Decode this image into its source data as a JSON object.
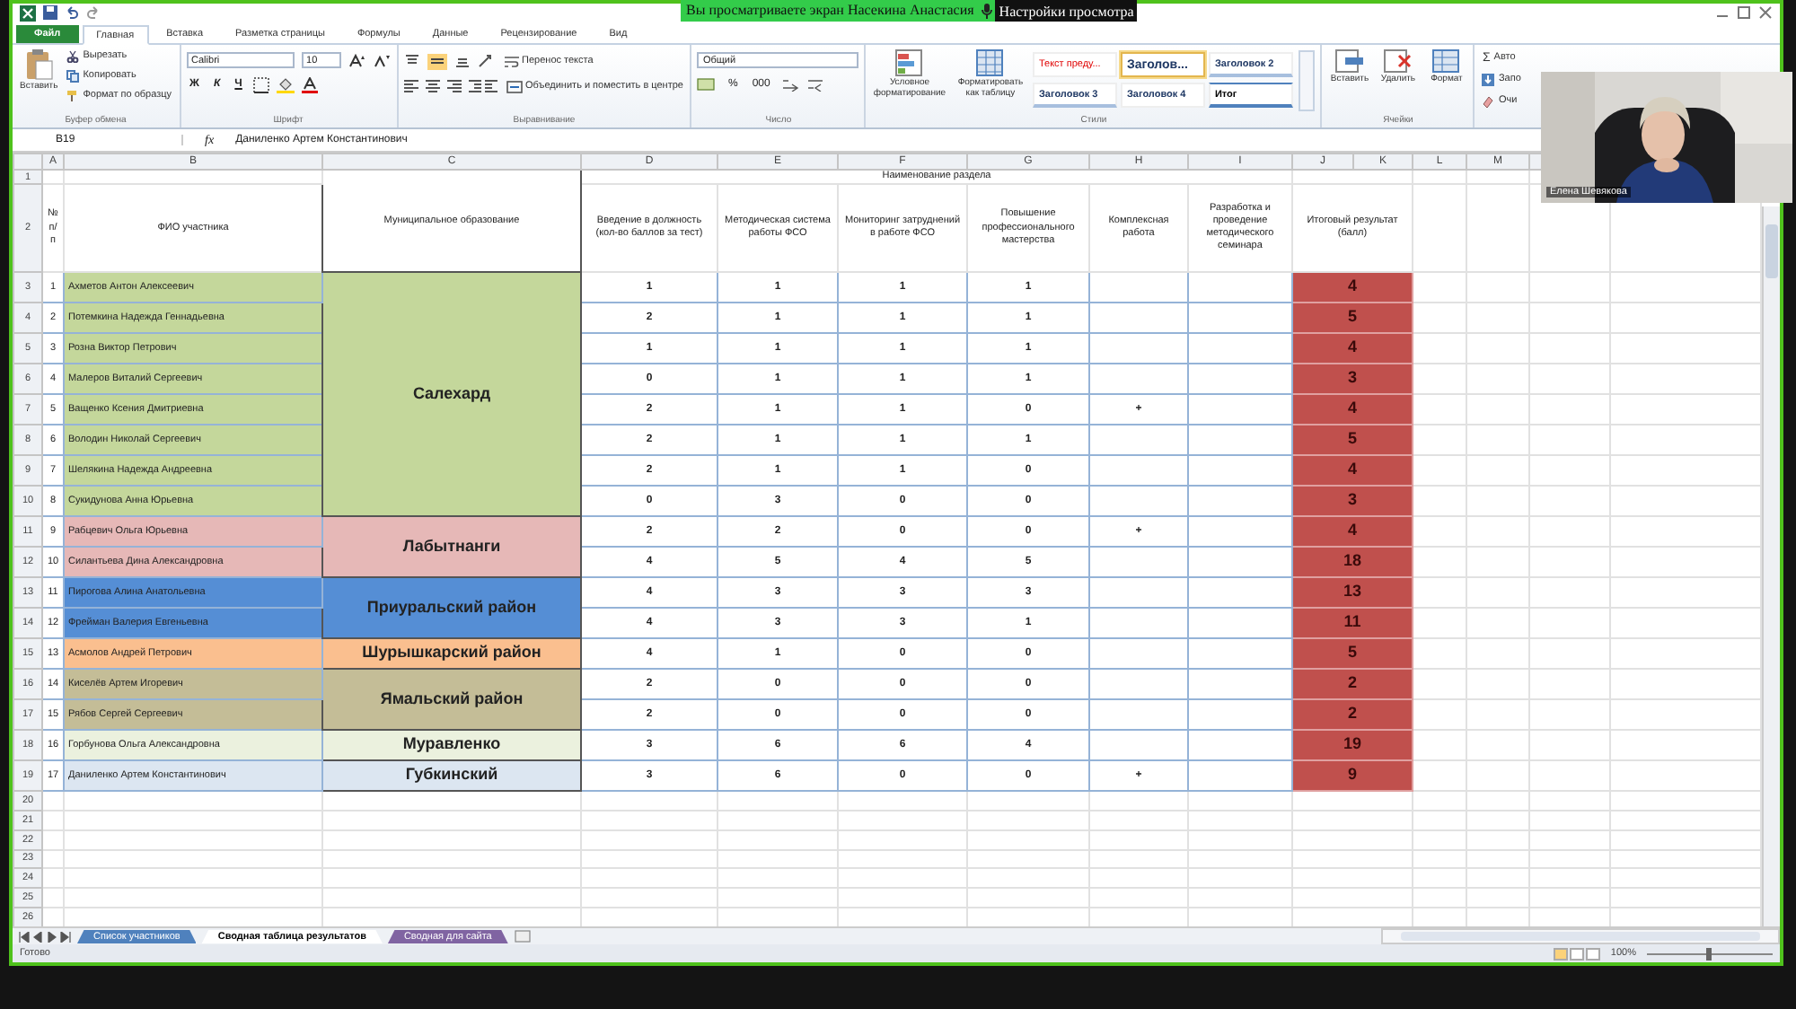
{
  "banner": {
    "text": "Вы просматриваете экран Насекина Анастасия",
    "settings": "Настройки просмотра"
  },
  "ribbon_tabs": [
    {
      "label": "Файл",
      "kind": "file",
      "selected": false
    },
    {
      "label": "Главная",
      "kind": "tab",
      "selected": true
    },
    {
      "label": "Вставка",
      "kind": "tab",
      "selected": false
    },
    {
      "label": "Разметка страницы",
      "kind": "tab",
      "selected": false
    },
    {
      "label": "Формулы",
      "kind": "tab",
      "selected": false
    },
    {
      "label": "Данные",
      "kind": "tab",
      "selected": false
    },
    {
      "label": "Рецензирование",
      "kind": "tab",
      "selected": false
    },
    {
      "label": "Вид",
      "kind": "tab",
      "selected": false
    }
  ],
  "clipboard": {
    "paste": "Вставить",
    "cut": "Вырезать",
    "copy": "Копировать",
    "format_painter": "Формат по образцу",
    "label": "Буфер обмена"
  },
  "font": {
    "family": "Calibri",
    "size": "10",
    "bold": "Ж",
    "italic": "К",
    "underline": "Ч",
    "label": "Шрифт"
  },
  "alignment": {
    "wrap": "Перенос текста",
    "merge": "Объединить и поместить в центре",
    "label": "Выравнивание"
  },
  "number": {
    "format": "Общий",
    "percent": "%",
    "thousands": "000",
    "label": "Число"
  },
  "styles": {
    "conditional": "Условное форматирование",
    "as_table": "Форматировать как таблицу",
    "label": "Стили",
    "gallery": [
      {
        "label": "Текст преду...",
        "kind": "warning",
        "selected": false
      },
      {
        "label": "Заголов...",
        "kind": "title",
        "selected": true
      },
      {
        "label": "Заголовок 2",
        "kind": "heading",
        "selected": false
      },
      {
        "label": "Заголовок 3",
        "kind": "heading",
        "selected": false
      },
      {
        "label": "Заголовок 4",
        "kind": "plain",
        "selected": false
      },
      {
        "label": "Итог",
        "kind": "total",
        "selected": false
      }
    ]
  },
  "cells": {
    "insert": "Вставить",
    "delete": "Удалить",
    "format": "Формат",
    "label": "Ячейки"
  },
  "editing": {
    "sigma": "Σ",
    "autosum": "Авто",
    "fill": "Запо",
    "clear": "Очи"
  },
  "formula_bar": {
    "name_box": "B19",
    "fx": "fx",
    "content": "Даниленко Артем Константинович"
  },
  "column_headers": [
    "A",
    "B",
    "C",
    "D",
    "E",
    "F",
    "G",
    "H",
    "I",
    "J",
    "K",
    "L",
    "M"
  ],
  "row_headers": [
    "1",
    "2",
    "3",
    "4",
    "5",
    "6",
    "7",
    "8",
    "9",
    "10",
    "11",
    "12",
    "13",
    "14",
    "15",
    "16",
    "17",
    "18",
    "19",
    "20",
    "21",
    "22",
    "23",
    "24",
    "25",
    "26"
  ],
  "table": {
    "section_title": "Наименование раздела",
    "num_header": "№ п/п",
    "name_header": "ФИО участника",
    "municipality_header": "Муниципальное образование",
    "score_headers": [
      "Введение в должность (кол-во баллов за тест)",
      "Методическая система работы ФСО",
      "Мониторинг затруднений в работе ФСО",
      "Повышение профессионального мастерства",
      "Комплексная работа",
      "Разработка и проведение методического семинара"
    ],
    "result_header": "Итоговый результат (балл)"
  },
  "groups": [
    {
      "municipality": "Салехард",
      "color": "#c4d79b",
      "rows": [
        {
          "num": "1",
          "name": "Ахметов Антон Алексеевич",
          "scores": [
            "1",
            "1",
            "1",
            "1"
          ],
          "result": "4"
        },
        {
          "num": "2",
          "name": "Потемкина Надежда Геннадьевна",
          "scores": [
            "2",
            "1",
            "1",
            "1"
          ],
          "result": "5"
        },
        {
          "num": "3",
          "name": "Розна Виктор Петрович",
          "scores": [
            "1",
            "1",
            "1",
            "1"
          ],
          "result": "4"
        },
        {
          "num": "4",
          "name": "Малеров Виталий Сергеевич",
          "scores": [
            "0",
            "1",
            "1",
            "1"
          ],
          "result": "3"
        },
        {
          "num": "5",
          "name": "Ващенко Ксения Дмитриевна",
          "scores": [
            "2",
            "1",
            "1",
            "0"
          ],
          "complex": "+",
          "result": "4"
        },
        {
          "num": "6",
          "name": "Володин Николай Сергеевич",
          "scores": [
            "2",
            "1",
            "1",
            "1"
          ],
          "result": "5"
        },
        {
          "num": "7",
          "name": "Шелякина Надежда Андреевна",
          "scores": [
            "2",
            "1",
            "1",
            "0"
          ],
          "result": "4"
        },
        {
          "num": "8",
          "name": "Сукидунова Анна Юрьевна",
          "scores": [
            "0",
            "3",
            "0",
            "0"
          ],
          "result": "3"
        }
      ]
    },
    {
      "municipality": "Лабытнанги",
      "color": "#e6b8b7",
      "rows": [
        {
          "num": "9",
          "name": "Рабцевич Ольга Юрьевна",
          "scores": [
            "2",
            "2",
            "0",
            "0"
          ],
          "complex": "+",
          "result": "4"
        },
        {
          "num": "10",
          "name": "Силантьева Дина Александровна",
          "scores": [
            "4",
            "5",
            "4",
            "5"
          ],
          "result": "18"
        }
      ]
    },
    {
      "municipality": "Приуральский район",
      "color": "#558ed5",
      "rows": [
        {
          "num": "11",
          "name": "Пирогова Алина Анатольевна",
          "scores": [
            "4",
            "3",
            "3",
            "3"
          ],
          "result": "13"
        },
        {
          "num": "12",
          "name": "Фрейман Валерия Евгеньевна",
          "scores": [
            "4",
            "3",
            "3",
            "1"
          ],
          "result": "11"
        }
      ]
    },
    {
      "municipality": "Шурышкарский район",
      "color": "#fabf8f",
      "rows": [
        {
          "num": "13",
          "name": "Асмолов Андрей Петрович",
          "scores": [
            "4",
            "1",
            "0",
            "0"
          ],
          "result": "5"
        }
      ]
    },
    {
      "municipality": "Ямальский район",
      "color": "#c4bd97",
      "rows": [
        {
          "num": "14",
          "name": "Киселёв Артем Игоревич",
          "scores": [
            "2",
            "0",
            "0",
            "0"
          ],
          "result": "2"
        },
        {
          "num": "15",
          "name": "Рябов Сергей Сергеевич",
          "scores": [
            "2",
            "0",
            "0",
            "0"
          ],
          "result": "2"
        }
      ]
    },
    {
      "municipality": "Муравленко",
      "color": "#ebf1de",
      "rows": [
        {
          "num": "16",
          "name": "Горбунова Ольга Александровна",
          "scores": [
            "3",
            "6",
            "6",
            "4"
          ],
          "result": "19"
        }
      ]
    },
    {
      "municipality": "Губкинский",
      "color": "#dce6f1",
      "rows": [
        {
          "num": "17",
          "name": "Даниленко Артем Константинович",
          "scores": [
            "3",
            "6",
            "0",
            "0"
          ],
          "complex": "+",
          "result": "9"
        }
      ]
    }
  ],
  "sheet_tabs": [
    {
      "label": "Список участников",
      "color": "#4f81bd",
      "selected": false
    },
    {
      "label": "Сводная таблица результатов",
      "selected": true
    },
    {
      "label": "Сводная для сайта",
      "color": "#8064a2",
      "selected": false
    }
  ],
  "status": {
    "text": "Готово",
    "zoom": "100%",
    "level": 0.5
  },
  "webcam": {
    "name": "Елена Шевякова"
  }
}
